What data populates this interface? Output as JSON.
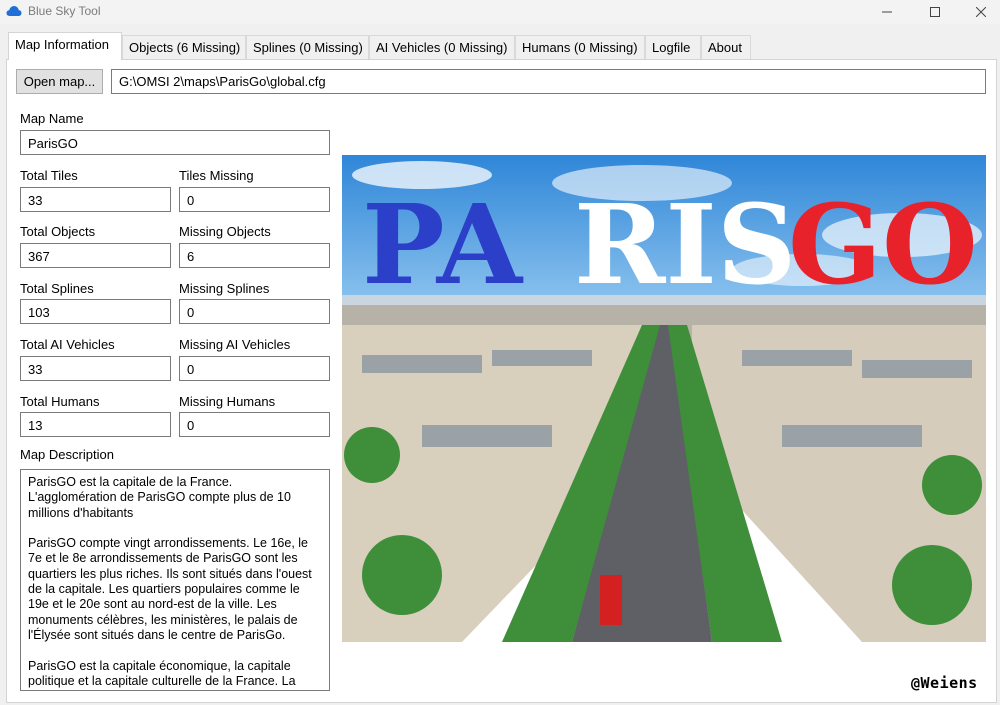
{
  "window": {
    "title": "Blue Sky Tool",
    "controls": {
      "minimize": "—",
      "maximize": "☐",
      "close": "✕"
    }
  },
  "tabs": [
    {
      "label": "Map Information",
      "active": true
    },
    {
      "label": "Objects (6 Missing)",
      "active": false
    },
    {
      "label": "Splines (0 Missing)",
      "active": false
    },
    {
      "label": "AI Vehicles (0 Missing)",
      "active": false
    },
    {
      "label": "Humans (0 Missing)",
      "active": false
    },
    {
      "label": "Logfile",
      "active": false
    },
    {
      "label": "About",
      "active": false
    }
  ],
  "toolbar": {
    "open_label": "Open map...",
    "path": "G:\\OMSI 2\\maps\\ParisGo\\global.cfg"
  },
  "fields": {
    "map_name": {
      "label": "Map Name",
      "value": "ParisGO"
    },
    "total_tiles": {
      "label": "Total Tiles",
      "value": "33"
    },
    "tiles_missing": {
      "label": "Tiles Missing",
      "value": "0"
    },
    "total_objects": {
      "label": "Total Objects",
      "value": "367"
    },
    "missing_objects": {
      "label": "Missing Objects",
      "value": "6"
    },
    "total_splines": {
      "label": "Total Splines",
      "value": "103"
    },
    "missing_splines": {
      "label": "Missing Splines",
      "value": "0"
    },
    "total_ai_vehicles": {
      "label": "Total AI Vehicles",
      "value": "33"
    },
    "missing_ai_vehicles": {
      "label": "Missing AI Vehicles",
      "value": "0"
    },
    "total_humans": {
      "label": "Total Humans",
      "value": "13"
    },
    "missing_humans": {
      "label": "Missing Humans",
      "value": "0"
    }
  },
  "description": {
    "label": "Map Description",
    "paragraphs": [
      "ParisGO est la capitale de la France. L'agglomération de ParisGO compte plus de 10 millions d'habitants",
      "ParisGO compte vingt arrondissements. Le 16e, le 7e et le 8e arrondissements de ParisGO sont les quartiers les plus riches. Ils sont situés dans l'ouest de la capitale. Les quartiers populaires comme le 19e et le 20e sont au nord-est de la ville. Les monuments célèbres, les ministères, le palais de l'Élysée sont situés dans le centre de ParisGo.",
      "ParisGO est la capitale économique, la capitale politique et la capitale culturelle de la France. La"
    ]
  },
  "poster": {
    "logo_parts": [
      "PA",
      "RIS",
      "GO"
    ],
    "logo_colors": [
      "#2b3fc8",
      "#ffffff",
      "#e8222a"
    ]
  },
  "watermark": "@Weiens"
}
